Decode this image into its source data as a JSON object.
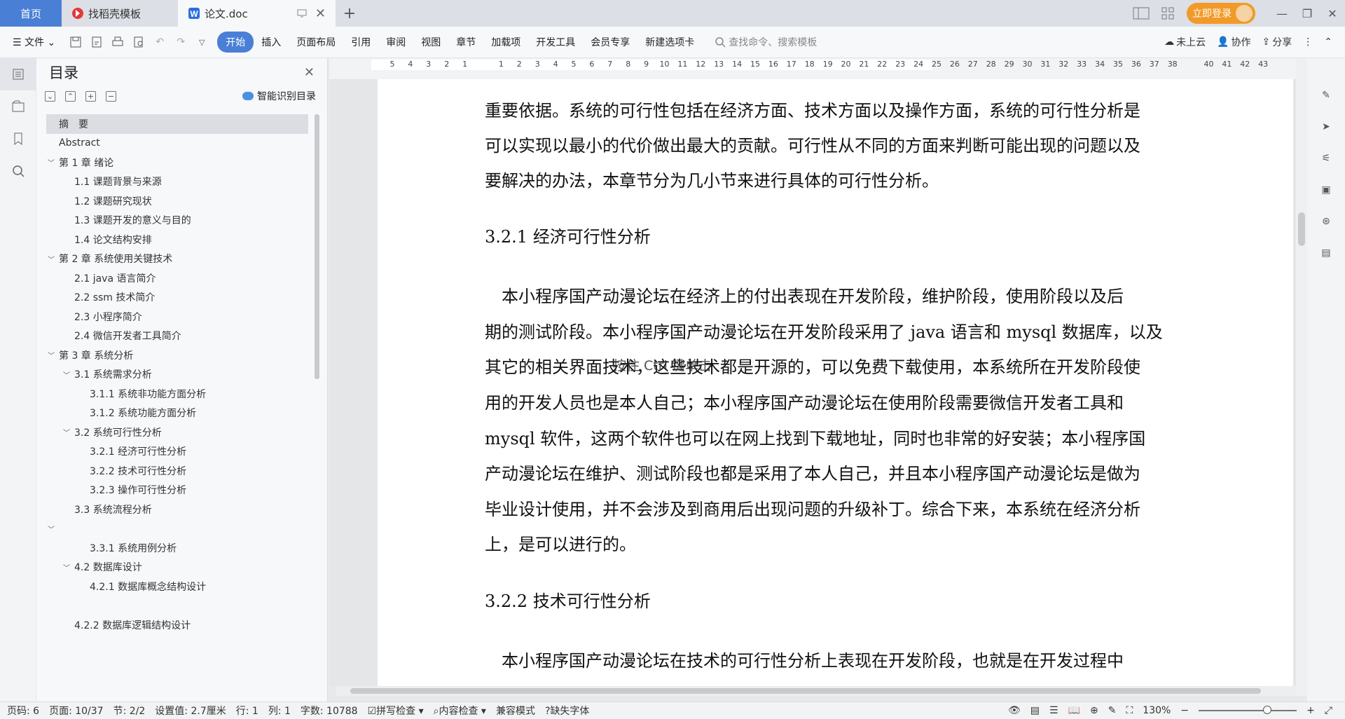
{
  "tabs": {
    "home": "首页",
    "template": "找稻壳模板",
    "doc": "论文.doc"
  },
  "login": "立即登录",
  "ribbon": {
    "file": "文件",
    "items": [
      "开始",
      "插入",
      "页面布局",
      "引用",
      "审阅",
      "视图",
      "章节",
      "加载项",
      "开发工具",
      "会员专享",
      "新建选项卡"
    ],
    "search": "查找命令、搜索模板",
    "cloud": "未上云",
    "collab": "协作",
    "share": "分享"
  },
  "toc": {
    "title": "目录",
    "smart": "智能识别目录",
    "items": [
      {
        "text": "摘　要",
        "level": 0,
        "caret": "",
        "selected": true
      },
      {
        "text": "Abstract",
        "level": 0,
        "caret": ""
      },
      {
        "text": "第 1 章  绪论",
        "level": 0,
        "caret": "v"
      },
      {
        "text": "1.1    课题背景与来源",
        "level": 1,
        "caret": ""
      },
      {
        "text": "1.2  课题研究现状",
        "level": 1,
        "caret": ""
      },
      {
        "text": "1.3 课题开发的意义与目的",
        "level": 1,
        "caret": ""
      },
      {
        "text": "1.4 论文结构安排",
        "level": 1,
        "caret": ""
      },
      {
        "text": "第 2 章  系统使用关键技术",
        "level": 0,
        "caret": "v"
      },
      {
        "text": "2.1 java 语言简介",
        "level": 1,
        "caret": ""
      },
      {
        "text": "2.2 ssm 技术简介",
        "level": 1,
        "caret": ""
      },
      {
        "text": "2.3  小程序简介",
        "level": 1,
        "caret": ""
      },
      {
        "text": "2.4  微信开发者工具简介",
        "level": 1,
        "caret": ""
      },
      {
        "text": "第 3 章  系统分析",
        "level": 0,
        "caret": "v"
      },
      {
        "text": "3.1  系统需求分析",
        "level": 1,
        "caret": "v"
      },
      {
        "text": "3.1.1 系统非功能方面分析",
        "level": 2,
        "caret": ""
      },
      {
        "text": "3.1.2 系统功能方面分析",
        "level": 2,
        "caret": ""
      },
      {
        "text": "3.2 系统可行性分析",
        "level": 1,
        "caret": "v"
      },
      {
        "text": "3.2.1  经济可行性分析",
        "level": 2,
        "caret": ""
      },
      {
        "text": "3.2.2    技术可行性分析",
        "level": 2,
        "caret": ""
      },
      {
        "text": "3.2.3    操作可行性分析",
        "level": 2,
        "caret": ""
      },
      {
        "text": "3.3 系统流程分析",
        "level": 1,
        "caret": ""
      },
      {
        "text": "",
        "level": 0,
        "caret": "v"
      },
      {
        "text": "3.3.1 系统用例分析",
        "level": 2,
        "caret": ""
      },
      {
        "text": "4.2 数据库设计",
        "level": 1,
        "caret": "v"
      },
      {
        "text": "4.2.1 数据库概念结构设计",
        "level": 2,
        "caret": ""
      },
      {
        "text": "",
        "level": 0,
        "caret": ""
      },
      {
        "text": "4.2.2 数据库逻辑结构设计",
        "level": 1,
        "caret": ""
      }
    ]
  },
  "ruler": {
    "numbers": [
      "5",
      "4",
      "3",
      "2",
      "1",
      "",
      "1",
      "2",
      "3",
      "4",
      "5",
      "6",
      "7",
      "8",
      "9",
      "10",
      "11",
      "12",
      "13",
      "14",
      "15",
      "16",
      "17",
      "18",
      "19",
      "20",
      "21",
      "22",
      "23",
      "24",
      "25",
      "26",
      "27",
      "28",
      "29",
      "30",
      "31",
      "32",
      "33",
      "34",
      "35",
      "36",
      "37",
      "38",
      "",
      "40",
      "41",
      "42",
      "43"
    ]
  },
  "doc": {
    "lines": [
      "重要依据。系统的可行性包括在经济方面、技术方面以及操作方面，系统的可行性分析是",
      "可以实现以最小的代价做出最大的贡献。可行性从不同的方面来判断可能出现的问题以及",
      "要解决的办法，本章节分为几小节来进行具体的可行性分析。"
    ],
    "h1": "3.2.1  经济可行性分析",
    "para2": [
      "　本小程序国产动漫论坛在经济上的付出表现在开发阶段，维护阶段，使用阶段以及后",
      "期的测试阶段。本小程序国产动漫论坛在开发阶段采用了 java 语言和 mysql 数据库，以及",
      "其它的相关界面技术，这些技术都是开源的，可以免费下载使用，本系统所在开发阶段使",
      "用的开发人员也是本人自己；本小程序国产动漫论坛在使用阶段需要微信开发者工具和",
      "mysql 软件，这两个软件也可以在网上找到下载地址，同时也非常的好安装；本小程序国",
      "产动漫论坛在维护、测试阶段也都是采用了本人自己，并且本小程序国产动漫论坛是做为",
      "毕业设计使用，并不会涉及到商用后出现问题的升级补丁。综合下来，本系统在经济分析",
      "上，是可以进行的。"
    ],
    "h2": "3.2.2    技术可行性分析",
    "para3": "　本小程序国产动漫论坛在技术的可行性分析上表现在开发阶段，也就是在开发过程中",
    "overlay": "按住 Ctrl 键单击"
  },
  "status": {
    "page": "页码: 6",
    "pages": "页面: 10/37",
    "section": "节: 2/2",
    "setting": "设置值: 2.7厘米",
    "row": "行: 1",
    "col": "列: 1",
    "words": "字数: 10788",
    "spell": "拼写检查",
    "content": "内容检查",
    "compat": "兼容模式",
    "font": "缺失字体",
    "zoom": "130%"
  }
}
